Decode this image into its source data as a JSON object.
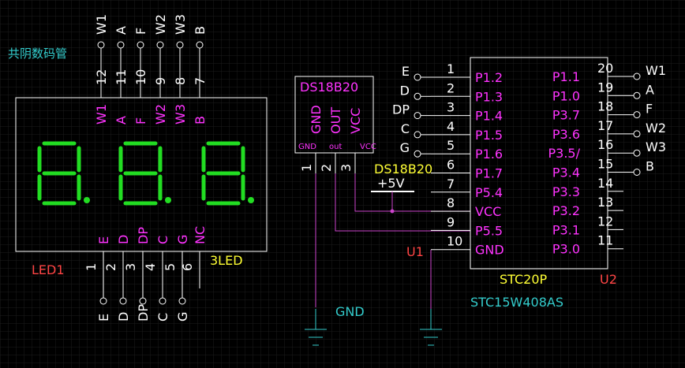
{
  "colors": {
    "background": "#000000",
    "grid": "#1c1c1c",
    "wire": "#ffffff",
    "wire_gnd": "#cc44cc",
    "wire_vcc": "#cc44cc",
    "pin_num": "#ffffff",
    "magenta": "#ff33ff",
    "cyan": "#33cccc",
    "yellow": "#ffff33",
    "red": "#ff4444",
    "segment": "#22dd22"
  },
  "led": {
    "chip_label": "共阴数码管",
    "designator": "LED1",
    "part": "3LED",
    "top_pins": [
      {
        "num": "12",
        "name": "W1"
      },
      {
        "num": "11",
        "name": "A"
      },
      {
        "num": "10",
        "name": "F"
      },
      {
        "num": "9",
        "name": "W2"
      },
      {
        "num": "8",
        "name": "W3"
      },
      {
        "num": "7",
        "name": "B"
      }
    ],
    "bottom_pins": [
      {
        "num": "1",
        "name": "E",
        "net": "E"
      },
      {
        "num": "2",
        "name": "D",
        "net": "D"
      },
      {
        "num": "3",
        "name": "DP",
        "net": "DP"
      },
      {
        "num": "4",
        "name": "C",
        "net": "C"
      },
      {
        "num": "5",
        "name": "G",
        "net": "G"
      },
      {
        "num": "6",
        "name": "NC",
        "net": ""
      }
    ]
  },
  "sensor": {
    "title": "DS18B20",
    "pins": [
      {
        "num": "1",
        "name": "GND",
        "small": "GND"
      },
      {
        "num": "2",
        "name": "OUT",
        "small": "out"
      },
      {
        "num": "3",
        "name": "VCC",
        "small": "VCC"
      }
    ]
  },
  "power": {
    "net_label": "DS18B20",
    "rail": "+5V",
    "gnd_label": "GND"
  },
  "mcu": {
    "designator_left": "U1",
    "designator_right": "U2",
    "part": "STC20P",
    "model": "STC15W408AS",
    "left_pins": [
      {
        "num": "1",
        "name": "P1.2",
        "net": "E"
      },
      {
        "num": "2",
        "name": "P1.3",
        "net": "D"
      },
      {
        "num": "3",
        "name": "P1.4",
        "net": "DP"
      },
      {
        "num": "4",
        "name": "P1.5",
        "net": "C"
      },
      {
        "num": "5",
        "name": "P1.6",
        "net": "G"
      },
      {
        "num": "6",
        "name": "P1.7",
        "net": ""
      },
      {
        "num": "7",
        "name": "P5.4",
        "net": ""
      },
      {
        "num": "8",
        "name": "VCC",
        "net": ""
      },
      {
        "num": "9",
        "name": "P5.5",
        "net": ""
      },
      {
        "num": "10",
        "name": "GND",
        "net": ""
      }
    ],
    "right_pins": [
      {
        "num": "20",
        "name": "P1.1",
        "net": "W1"
      },
      {
        "num": "19",
        "name": "P1.0",
        "net": "A"
      },
      {
        "num": "18",
        "name": "P3.7",
        "net": "F"
      },
      {
        "num": "17",
        "name": "P3.6",
        "net": "W2"
      },
      {
        "num": "16",
        "name": "P3.5/",
        "net": "W3"
      },
      {
        "num": "15",
        "name": "P3.4",
        "net": "B"
      },
      {
        "num": "14",
        "name": "P3.3",
        "net": ""
      },
      {
        "num": "13",
        "name": "P3.2",
        "net": ""
      },
      {
        "num": "12",
        "name": "P3.1",
        "net": ""
      },
      {
        "num": "11",
        "name": "P3.0",
        "net": ""
      }
    ]
  }
}
